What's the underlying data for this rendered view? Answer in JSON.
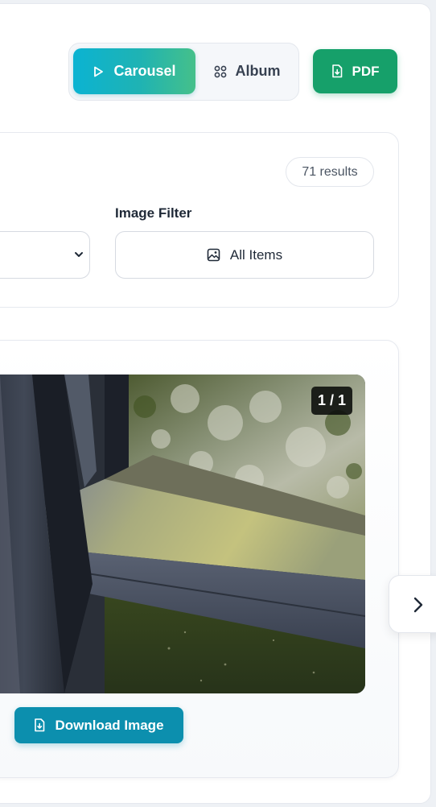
{
  "toolbar": {
    "carousel_label": "Carousel",
    "album_label": "Album",
    "pdf_label": "PDF",
    "active_view": "Carousel"
  },
  "filters": {
    "results_count": "71 results",
    "image_filter_label": "Image Filter",
    "image_filter_value": "All Items"
  },
  "viewer": {
    "counter": "1 / 1",
    "download_label": "Download Image",
    "photo_icon": "photo-window-frame-with-algae"
  },
  "colors": {
    "carousel_gradient_start": "#0bb3d2",
    "carousel_gradient_end": "#45c08a",
    "pdf_green": "#16a06a",
    "download_teal": "#0c8fae"
  }
}
